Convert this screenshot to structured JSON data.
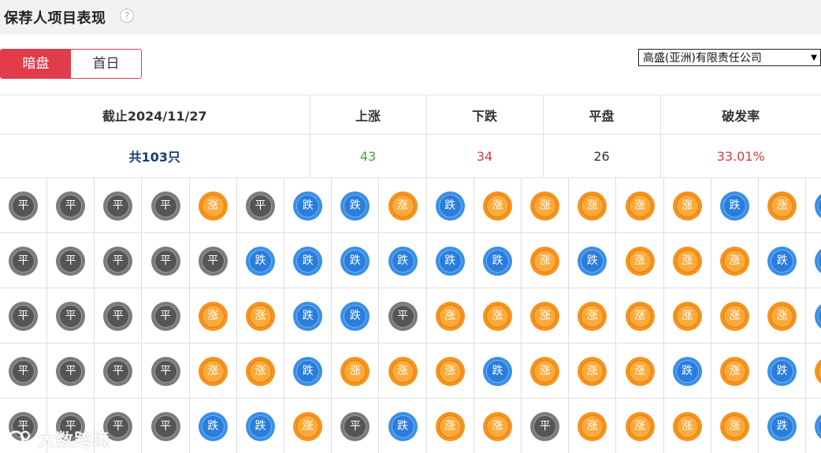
{
  "header": {
    "title": "保荐人项目表现",
    "help_icon": "?"
  },
  "tabs": [
    {
      "label": "暗盘",
      "active": true
    },
    {
      "label": "首日",
      "active": false
    }
  ],
  "sponsor_select": {
    "selected": "高盛(亚洲)有限责任公司"
  },
  "summary": {
    "headers": [
      "截止2024/11/27",
      "上涨",
      "下跌",
      "平盘",
      "破发率"
    ],
    "total": "共103只",
    "up": "43",
    "down": "34",
    "flat": "26",
    "break_rate": "33.01%"
  },
  "legend_labels": {
    "flat": "平",
    "up": "涨",
    "down": "跌"
  },
  "colors": {
    "accent_red": "#e03c4c",
    "up_green": "#3aa640",
    "down_red": "#d23c48",
    "coin_up": "#f7931e",
    "coin_down": "#3b8fe6",
    "coin_flat": "#7b7b7b"
  },
  "grid": [
    [
      "flat",
      "flat",
      "flat",
      "flat",
      "up",
      "flat",
      "down",
      "down",
      "up",
      "down",
      "up",
      "up",
      "up",
      "up",
      "up",
      "down",
      "up",
      "down"
    ],
    [
      "flat",
      "flat",
      "flat",
      "flat",
      "flat",
      "down",
      "down",
      "down",
      "down",
      "down",
      "down",
      "up",
      "down",
      "up",
      "up",
      "up",
      "down",
      "down"
    ],
    [
      "flat",
      "flat",
      "flat",
      "flat",
      "up",
      "up",
      "down",
      "down",
      "flat",
      "up",
      "up",
      "up",
      "up",
      "up",
      "up",
      "up",
      "up",
      "down"
    ],
    [
      "flat",
      "flat",
      "flat",
      "flat",
      "up",
      "up",
      "down",
      "up",
      "up",
      "up",
      "down",
      "up",
      "up",
      "up",
      "down",
      "up",
      "down",
      "up"
    ],
    [
      "flat",
      "flat",
      "flat",
      "flat",
      "down",
      "down",
      "up",
      "flat",
      "down",
      "up",
      "up",
      "flat",
      "up",
      "up",
      "up",
      "up",
      "down",
      "down"
    ]
  ],
  "watermark": {
    "text": "大数跨境"
  }
}
